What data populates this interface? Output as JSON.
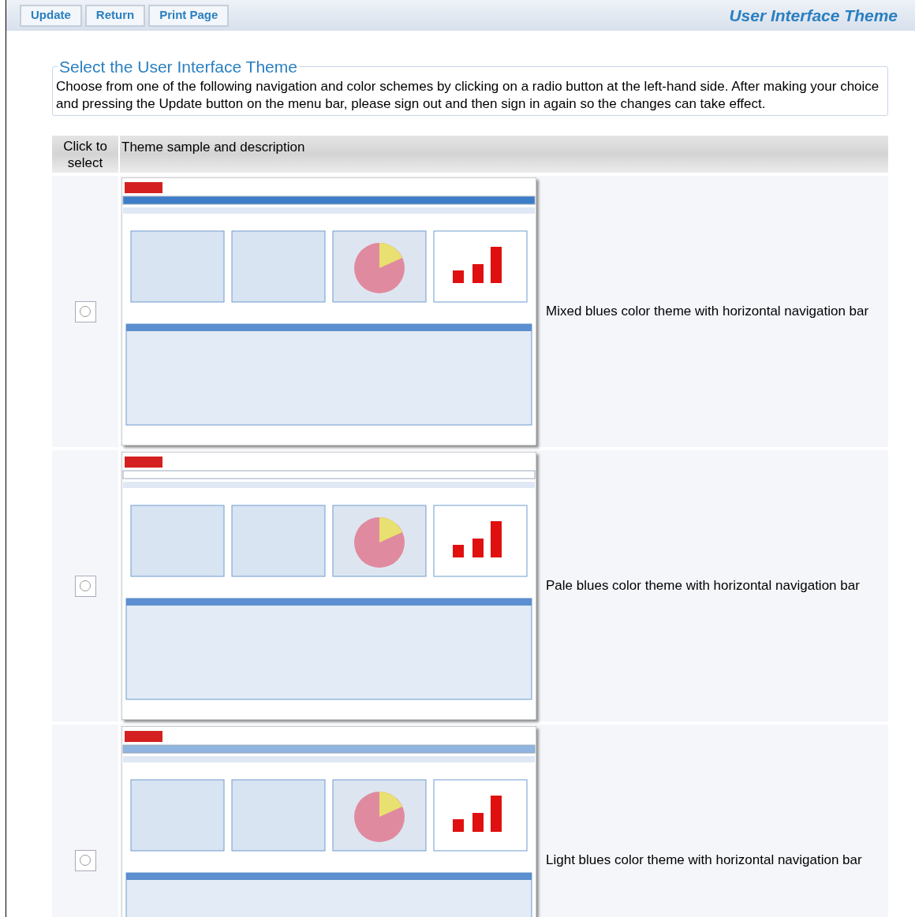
{
  "toolbar": {
    "buttons": [
      "Update",
      "Return",
      "Print Page"
    ],
    "title": "User Interface Theme"
  },
  "intro": {
    "legend": "Select the User Interface Theme",
    "text": "Choose from one of the following navigation and color schemes by clicking on a radio button at the left-hand side. After making your choice and pressing the Update button on the menu bar, please sign out and then sign in again so the changes can take effect."
  },
  "table": {
    "columns": [
      "Click to select",
      "Theme sample and description"
    ],
    "rows": [
      {
        "selected": false,
        "description": "Mixed blues color theme with horizontal navigation bar"
      },
      {
        "selected": false,
        "description": "Pale blues color theme with horizontal navigation bar"
      },
      {
        "selected": false,
        "description": "Light blues color theme with horizontal navigation bar"
      }
    ]
  }
}
